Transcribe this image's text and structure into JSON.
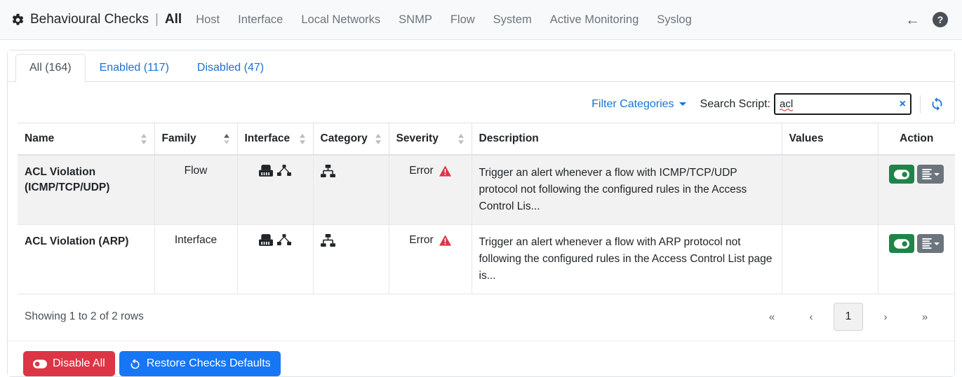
{
  "navbar": {
    "gear_icon": "gear-icon",
    "brand": "Behavioural Checks",
    "separator": "|",
    "active_section": "All",
    "links": [
      {
        "label": "Host"
      },
      {
        "label": "Interface"
      },
      {
        "label": "Local Networks"
      },
      {
        "label": "SNMP"
      },
      {
        "label": "Flow"
      },
      {
        "label": "System"
      },
      {
        "label": "Active Monitoring"
      },
      {
        "label": "Syslog"
      }
    ],
    "back_icon": "←",
    "help_icon": "?"
  },
  "tabs": [
    {
      "label": "All (164)",
      "active": true
    },
    {
      "label": "Enabled (117)",
      "active": false
    },
    {
      "label": "Disabled (47)",
      "active": false
    }
  ],
  "toolbar": {
    "filter_categories_label": "Filter Categories",
    "search_label": "Search Script:",
    "search_value": "acl",
    "search_placeholder": "",
    "clear_icon": "×",
    "refresh_icon": "sync-icon"
  },
  "table": {
    "columns": [
      {
        "label": "Name",
        "sort": "both"
      },
      {
        "label": "Family",
        "sort": "asc"
      },
      {
        "label": "Interface",
        "sort": "both"
      },
      {
        "label": "Category",
        "sort": "both"
      },
      {
        "label": "Severity",
        "sort": "both"
      },
      {
        "label": "Description",
        "sort": "none"
      },
      {
        "label": "Values",
        "sort": "none"
      },
      {
        "label": "Action",
        "sort": "none"
      }
    ],
    "rows": [
      {
        "name": "ACL Violation (ICMP/TCP/UDP)",
        "family": "Flow",
        "interface_icons": [
          "ethernet-icon",
          "project-diagram-icon"
        ],
        "category_icons": [
          "sitemap-icon"
        ],
        "severity": "Error",
        "severity_icon": "warning-triangle-icon",
        "description": "Trigger an alert whenever a flow with ICMP/TCP/UDP protocol not following the configured rules in the Access Control Lis...",
        "values": "",
        "actions": [
          "toggle-on-button",
          "list-dropdown-button"
        ]
      },
      {
        "name": "ACL Violation (ARP)",
        "family": "Interface",
        "interface_icons": [
          "ethernet-icon",
          "project-diagram-icon"
        ],
        "category_icons": [
          "sitemap-icon"
        ],
        "severity": "Error",
        "severity_icon": "warning-triangle-icon",
        "description": "Trigger an alert whenever a flow with ARP protocol not following the configured rules in the Access Control List page is...",
        "values": "",
        "actions": [
          "toggle-on-button",
          "list-dropdown-button"
        ]
      }
    ]
  },
  "footer": {
    "showing_text": "Showing 1 to 2 of 2 rows",
    "pagination": [
      {
        "label": "«",
        "active": false
      },
      {
        "label": "‹",
        "active": false
      },
      {
        "label": "1",
        "active": true
      },
      {
        "label": "›",
        "active": false
      },
      {
        "label": "»",
        "active": false
      }
    ]
  },
  "bottom": {
    "disable_all_label": "Disable All",
    "restore_defaults_label": "Restore Checks Defaults"
  },
  "colors": {
    "link": "#1a73d1",
    "danger": "#dc3545",
    "primary": "#1676f3",
    "success": "#1e8449",
    "secondary": "#6c757d",
    "error_icon": "#dc3545"
  }
}
